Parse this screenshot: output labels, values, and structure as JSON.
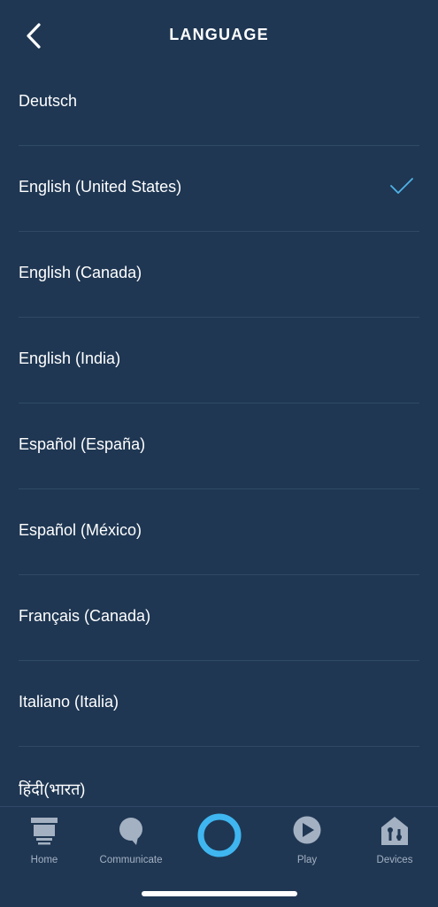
{
  "header": {
    "title": "LANGUAGE",
    "back_icon": "chevron-left-icon"
  },
  "languages": [
    {
      "label": "Deutsch",
      "selected": false
    },
    {
      "label": "English (United States)",
      "selected": true
    },
    {
      "label": "English (Canada)",
      "selected": false
    },
    {
      "label": "English (India)",
      "selected": false
    },
    {
      "label": "Español (España)",
      "selected": false
    },
    {
      "label": "Español (México)",
      "selected": false
    },
    {
      "label": "Français (Canada)",
      "selected": false
    },
    {
      "label": "Italiano (Italia)",
      "selected": false
    },
    {
      "label": "हिंदी(भारत)",
      "selected": false
    }
  ],
  "tabbar": {
    "home": "Home",
    "communicate": "Communicate",
    "play": "Play",
    "devices": "Devices"
  },
  "colors": {
    "background": "#1f3753",
    "checkmark": "#4fb3e8",
    "alexa_ring": "#3fb6f0",
    "tab_icon": "#a4b1c2"
  }
}
